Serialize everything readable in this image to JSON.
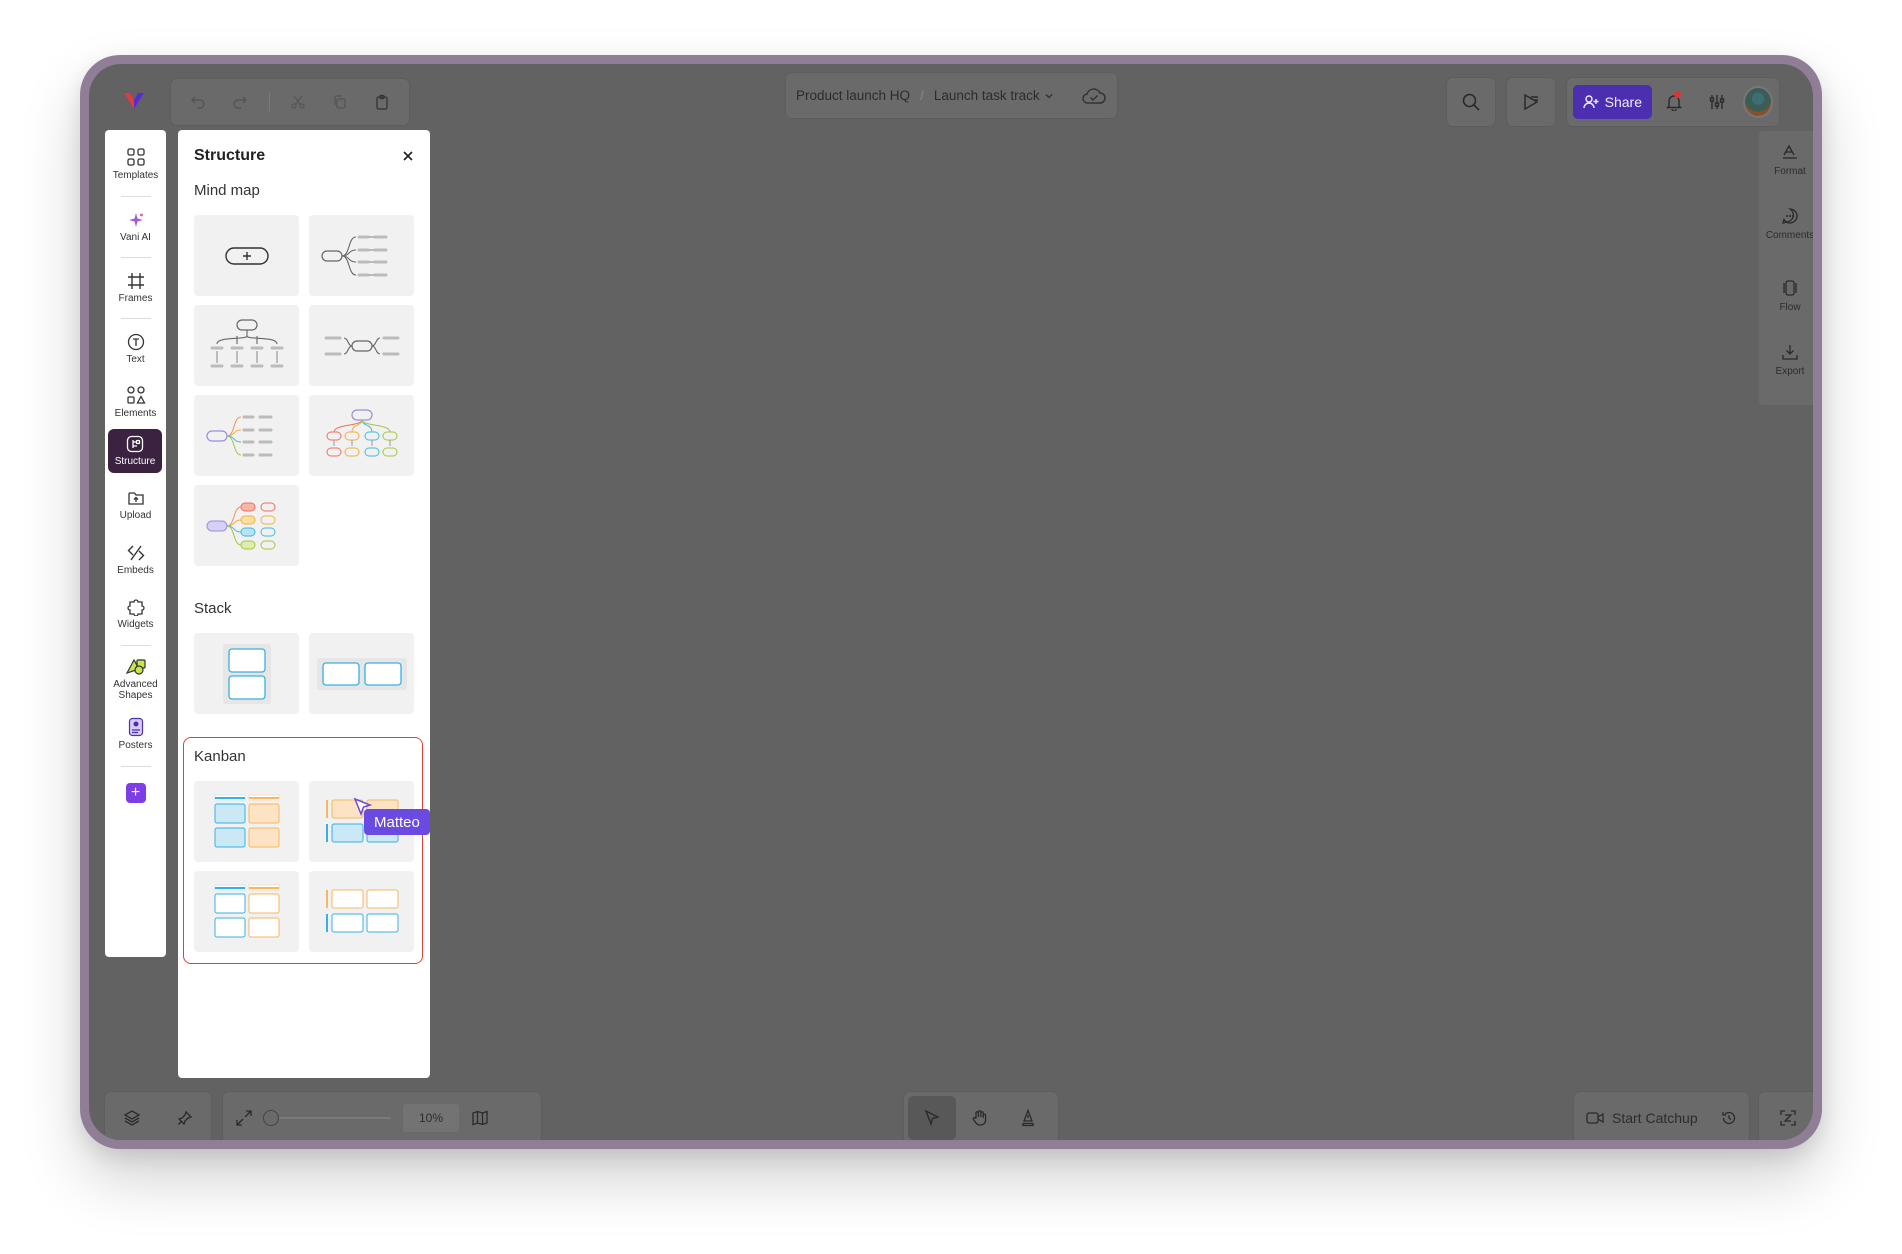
{
  "topbar": {
    "logo_icon": "vani-logo-icon",
    "breadcrumb": {
      "workspace": "Product launch HQ",
      "separator": "/",
      "board": "Launch task track"
    },
    "share_label": "Share"
  },
  "left_sidebar": {
    "items": [
      {
        "label": "Templates",
        "icon": "templates-icon"
      },
      {
        "label": "Vani AI",
        "icon": "sparkle-icon"
      },
      {
        "label": "Frames",
        "icon": "frame-hash-icon"
      },
      {
        "label": "Text",
        "icon": "text-icon"
      },
      {
        "label": "Elements",
        "icon": "elements-icon"
      },
      {
        "label": "Structure",
        "icon": "structure-icon",
        "active": true
      },
      {
        "label": "Upload",
        "icon": "upload-icon"
      },
      {
        "label": "Embeds",
        "icon": "embeds-icon"
      },
      {
        "label": "Widgets",
        "icon": "widgets-icon"
      },
      {
        "label": "Advanced Shapes",
        "icon": "advanced-shapes-icon"
      },
      {
        "label": "Posters",
        "icon": "posters-icon"
      }
    ],
    "add_label": "+"
  },
  "structure_panel": {
    "title": "Structure",
    "sections": [
      {
        "title": "Mind map",
        "template_count": 7
      },
      {
        "title": "Stack",
        "template_count": 2
      },
      {
        "title": "Kanban",
        "template_count": 4,
        "highlighted": true
      }
    ]
  },
  "right_sidebar": {
    "items": [
      {
        "label": "Format",
        "icon": "format-icon"
      },
      {
        "label": "Comments",
        "icon": "comments-icon"
      },
      {
        "label": "Flow",
        "icon": "flow-icon"
      },
      {
        "label": "Export",
        "icon": "export-icon"
      }
    ]
  },
  "bottom_bar": {
    "zoom": "10%",
    "catchup_label": "Start Catchup"
  },
  "collaborator_cursor": {
    "name": "Matteo",
    "color": "#6a4ae0"
  },
  "colors": {
    "canvas": "#626262",
    "frame": "#8f7e95",
    "accent": "#4b2fb0",
    "highlight": "#e0403a"
  }
}
